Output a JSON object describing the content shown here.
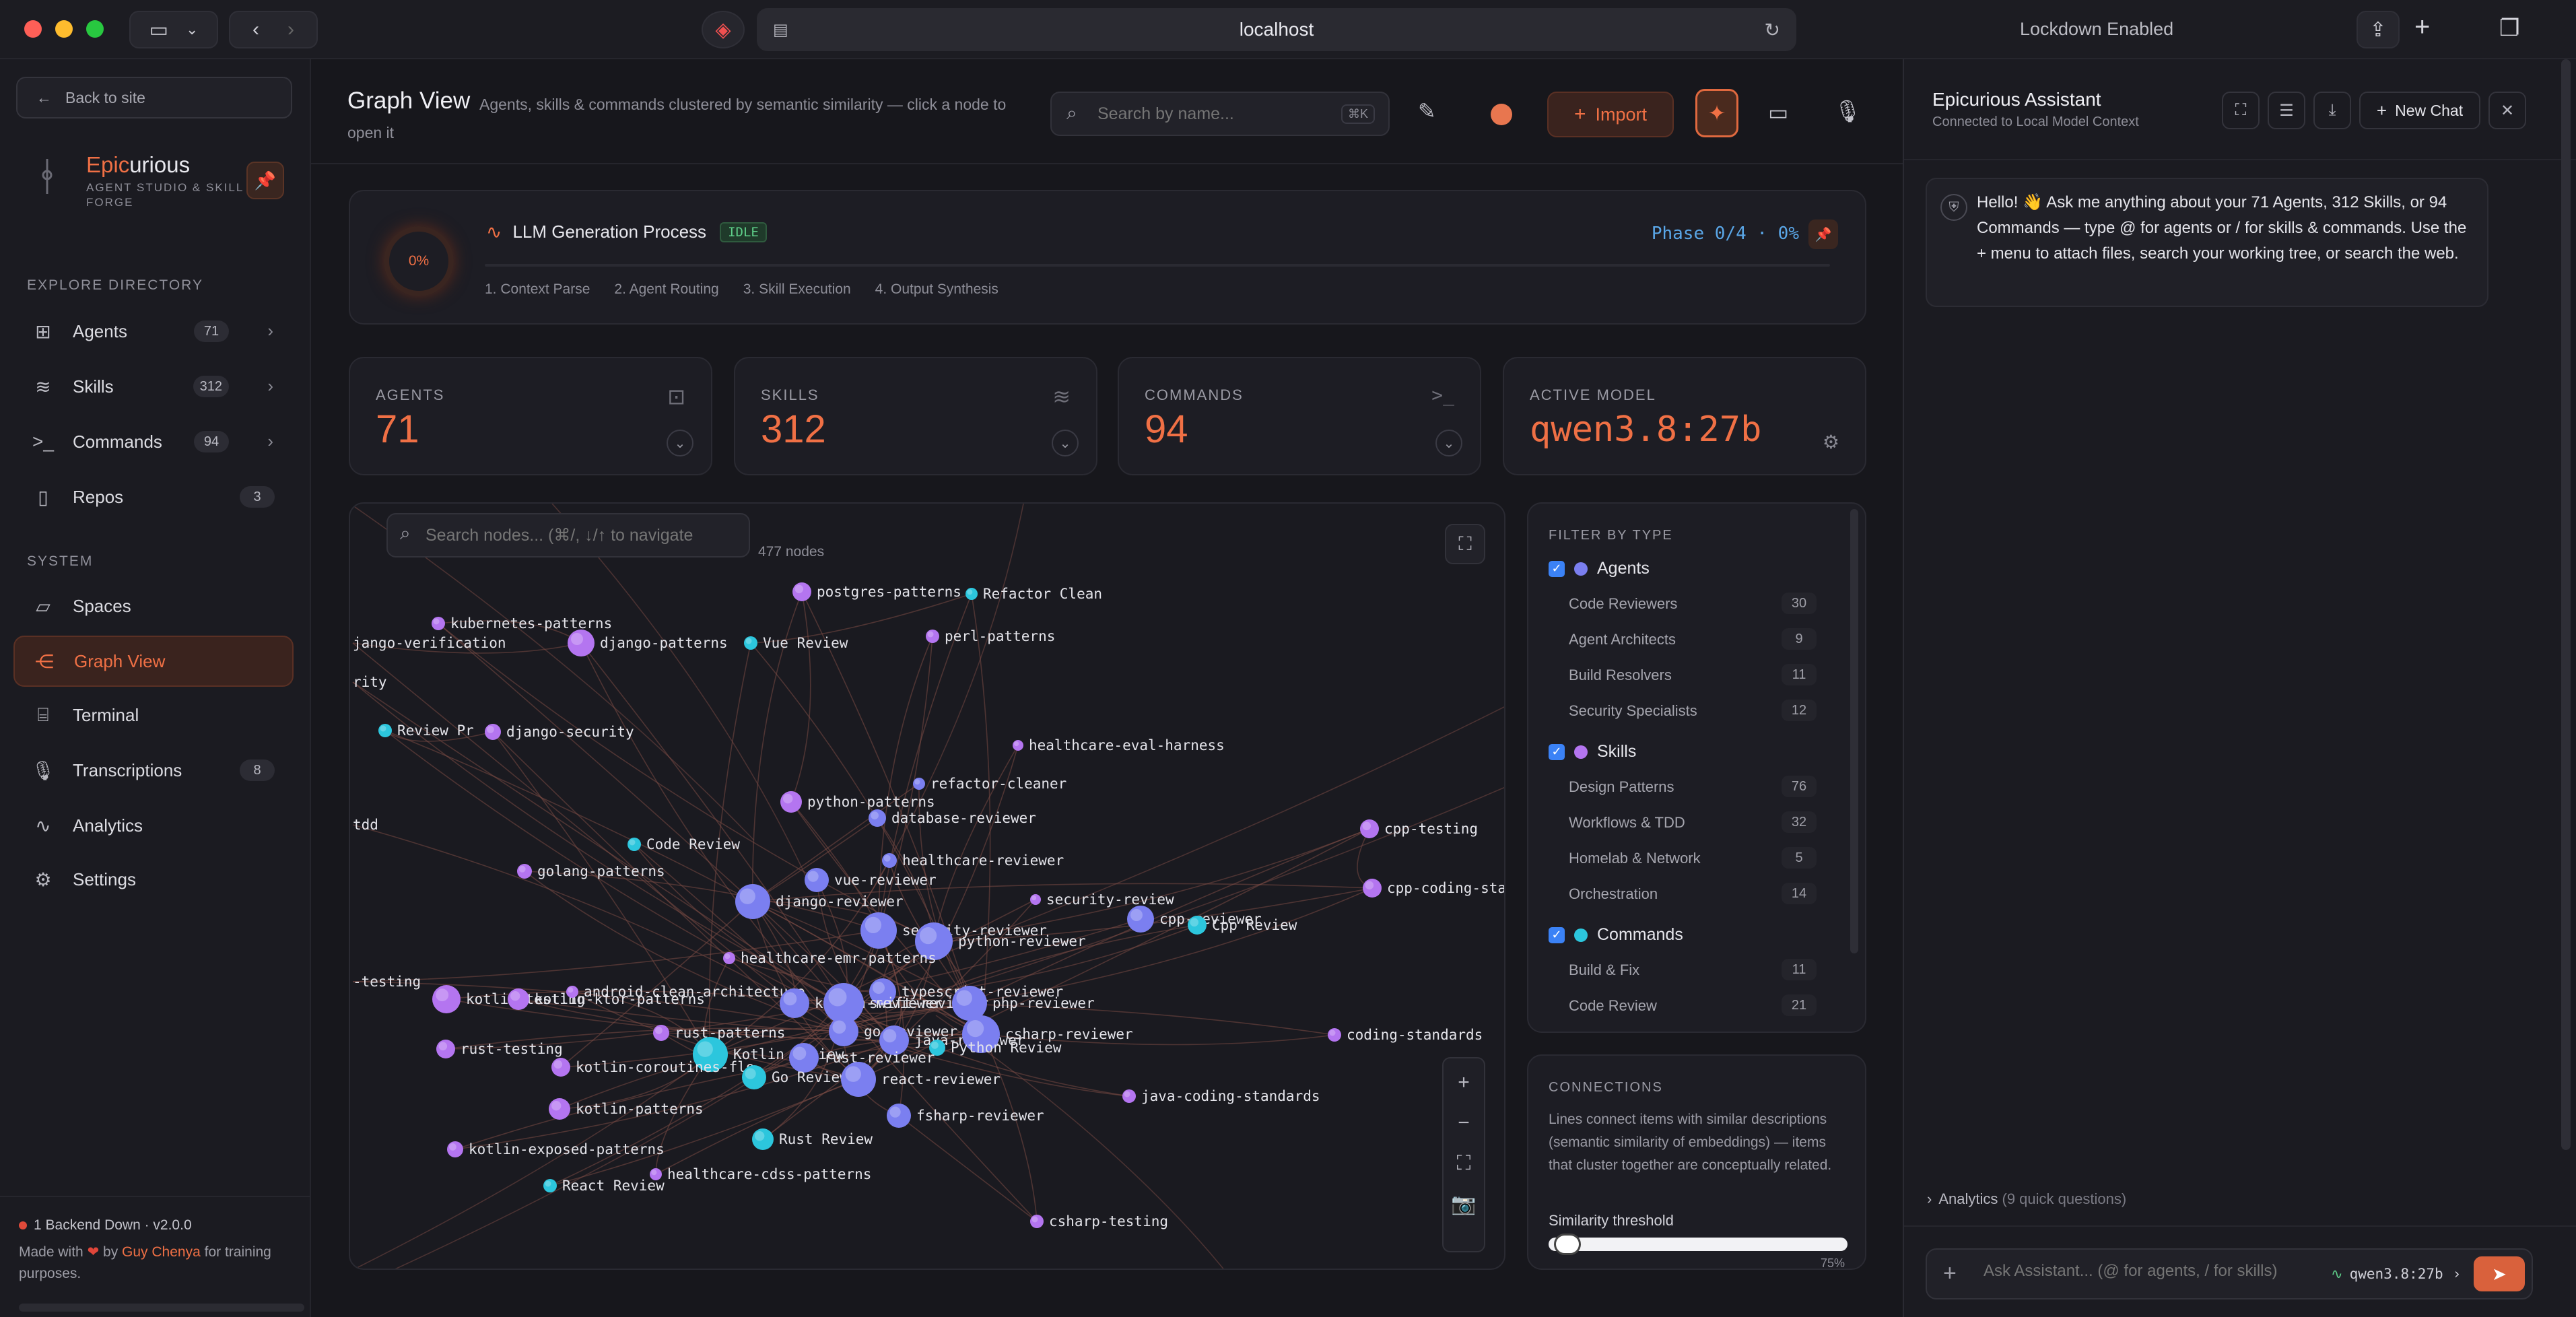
{
  "browser": {
    "url": "localhost",
    "lockdown": "Lockdown Enabled"
  },
  "sidebar": {
    "back": "Back to site",
    "brand_prefix": "Epic",
    "brand_suffix": "urious",
    "brand_tagline_1": "AGENT STUDIO & SKILL",
    "brand_tagline_2": "FORGE",
    "explore_label": "EXPLORE DIRECTORY",
    "system_label": "SYSTEM",
    "explore": [
      {
        "label": "Agents",
        "badge": "71"
      },
      {
        "label": "Skills",
        "badge": "312"
      },
      {
        "label": "Commands",
        "badge": "94"
      },
      {
        "label": "Repos",
        "badge": "3"
      }
    ],
    "system": [
      {
        "label": "Spaces",
        "badge": ""
      },
      {
        "label": "Graph View",
        "badge": ""
      },
      {
        "label": "Terminal",
        "badge": ""
      },
      {
        "label": "Transcriptions",
        "badge": "8"
      },
      {
        "label": "Analytics",
        "badge": ""
      },
      {
        "label": "Settings",
        "badge": ""
      }
    ],
    "footer_status": "1 Backend Down · v2.0.0",
    "footer_made": "Made with",
    "footer_by": "by",
    "footer_author": "Guy Chenya",
    "footer_tail": "for training purposes."
  },
  "header": {
    "title": "Graph View",
    "subtitle": "Agents, skills & commands clustered by semantic similarity — click a node to open it",
    "search_placeholder": "Search by name...",
    "search_shortcut": "⌘K",
    "import_label": "Import"
  },
  "process": {
    "percent": "0%",
    "title": "LLM Generation Process",
    "status": "IDLE",
    "phase": "Phase 0/4 · 0%",
    "steps": [
      "1. Context Parse",
      "2. Agent Routing",
      "3. Skill Execution",
      "4. Output Synthesis"
    ]
  },
  "stats": [
    {
      "label": "AGENTS",
      "value": "71"
    },
    {
      "label": "SKILLS",
      "value": "312"
    },
    {
      "label": "COMMANDS",
      "value": "94"
    },
    {
      "label": "ACTIVE MODEL",
      "value": "qwen3.8:27b"
    }
  ],
  "graph": {
    "search_placeholder": "Search nodes... (⌘/, ↓/↑ to navigate",
    "node_count": "477 nodes",
    "nodes": [
      {
        "label": "postgres-patterns",
        "type": "skill"
      },
      {
        "label": "Refactor Clean",
        "type": "command"
      },
      {
        "label": "kubernetes-patterns",
        "type": "skill"
      },
      {
        "label": "jango-verification",
        "type": "skill"
      },
      {
        "label": "django-patterns",
        "type": "skill"
      },
      {
        "label": "Vue Review",
        "type": "command"
      },
      {
        "label": "perl-patterns",
        "type": "skill"
      },
      {
        "label": "rity",
        "type": "skill"
      },
      {
        "label": "Review Pr",
        "type": "command"
      },
      {
        "label": "django-security",
        "type": "skill"
      },
      {
        "label": "healthcare-eval-harness",
        "type": "skill"
      },
      {
        "label": "refactor-cleaner",
        "type": "agent"
      },
      {
        "label": "python-patterns",
        "type": "skill"
      },
      {
        "label": "database-reviewer",
        "type": "agent"
      },
      {
        "label": "tdd",
        "type": "skill"
      },
      {
        "label": "Code Review",
        "type": "command"
      },
      {
        "label": "healthcare-reviewer",
        "type": "agent"
      },
      {
        "label": "golang-patterns",
        "type": "skill"
      },
      {
        "label": "vue-reviewer",
        "type": "agent"
      },
      {
        "label": "django-reviewer",
        "type": "agent"
      },
      {
        "label": "security-review",
        "type": "skill"
      },
      {
        "label": "cpp-testing",
        "type": "skill"
      },
      {
        "label": "cpp-coding-stan",
        "type": "skill"
      },
      {
        "label": "security-reviewer",
        "type": "agent"
      },
      {
        "label": "python-reviewer",
        "type": "agent"
      },
      {
        "label": "cpp-reviewer",
        "type": "agent"
      },
      {
        "label": "Cpp Review",
        "type": "command"
      },
      {
        "label": "healthcare-emr-patterns",
        "type": "skill"
      },
      {
        "label": "-testing",
        "type": "skill"
      },
      {
        "label": "kotlin-testing",
        "type": "skill"
      },
      {
        "label": "kotlin-ktor-patterns",
        "type": "skill"
      },
      {
        "label": "android-clean-architecture",
        "type": "skill"
      },
      {
        "label": "typescript-reviewer",
        "type": "agent"
      },
      {
        "label": "kotlin-reviewer",
        "type": "agent"
      },
      {
        "label": "swift-reviewer",
        "type": "agent"
      },
      {
        "label": "php-reviewer",
        "type": "agent"
      },
      {
        "label": "go-reviewer",
        "type": "agent"
      },
      {
        "label": "rust-testing",
        "type": "skill"
      },
      {
        "label": "rust-patterns",
        "type": "skill"
      },
      {
        "label": "java-reviewer",
        "type": "agent"
      },
      {
        "label": "csharp-reviewer",
        "type": "agent"
      },
      {
        "label": "Python Review",
        "type": "command"
      },
      {
        "label": "Kotlin Review",
        "type": "command"
      },
      {
        "label": "rust-reviewer",
        "type": "agent"
      },
      {
        "label": "kotlin-coroutines-flo",
        "type": "skill"
      },
      {
        "label": "Go Review",
        "type": "command"
      },
      {
        "label": "react-reviewer",
        "type": "agent"
      },
      {
        "label": "coding-standards",
        "type": "skill"
      },
      {
        "label": "java-coding-standards",
        "type": "skill"
      },
      {
        "label": "kotlin-patterns",
        "type": "skill"
      },
      {
        "label": "fsharp-reviewer",
        "type": "agent"
      },
      {
        "label": "Rust Review",
        "type": "command"
      },
      {
        "label": "kotlin-exposed-patterns",
        "type": "skill"
      },
      {
        "label": "healthcare-cdss-patterns",
        "type": "skill"
      },
      {
        "label": "React Review",
        "type": "command"
      },
      {
        "label": "csharp-testing",
        "type": "skill"
      }
    ]
  },
  "filter": {
    "title": "FILTER BY TYPE",
    "groups": [
      {
        "label": "Agents",
        "color": "#7b7ff0",
        "items": [
          {
            "label": "Code Reviewers",
            "count": "30"
          },
          {
            "label": "Agent Architects",
            "count": "9"
          },
          {
            "label": "Build Resolvers",
            "count": "11"
          },
          {
            "label": "Security Specialists",
            "count": "12"
          }
        ]
      },
      {
        "label": "Skills",
        "color": "#b475f0",
        "items": [
          {
            "label": "Design Patterns",
            "count": "76"
          },
          {
            "label": "Workflows & TDD",
            "count": "32"
          },
          {
            "label": "Homelab & Network",
            "count": "5"
          },
          {
            "label": "Orchestration",
            "count": "14"
          }
        ]
      },
      {
        "label": "Commands",
        "color": "#2cc6dd",
        "items": [
          {
            "label": "Build & Fix",
            "count": "11"
          },
          {
            "label": "Code Review",
            "count": "21"
          }
        ]
      }
    ]
  },
  "connections": {
    "title": "CONNECTIONS",
    "text": "Lines connect items with similar descriptions (semantic similarity of embeddings) — items that cluster together are conceptually related.",
    "threshold_label": "Similarity threshold",
    "threshold_value": "75%",
    "threshold_fraction": 0.02
  },
  "assistant": {
    "title": "Epicurious Assistant",
    "subtitle": "Connected to Local Model Context",
    "new_chat": "New Chat",
    "message": "Hello! 👋 Ask me anything about your 71 Agents, 312 Skills, or 94 Commands — type @ for agents or / for skills & commands. Use the + menu to attach files, search your working tree, or search the web.",
    "analytics": "Analytics",
    "analytics_hint": "(9 quick questions)",
    "input_placeholder": "Ask Assistant... (@ for agents, / for skills)",
    "model": "qwen3.8:27b"
  },
  "colors": {
    "accent": "#f07045",
    "agent": "#7b7ff0",
    "skill": "#b475f0",
    "command": "#2cc6dd"
  }
}
